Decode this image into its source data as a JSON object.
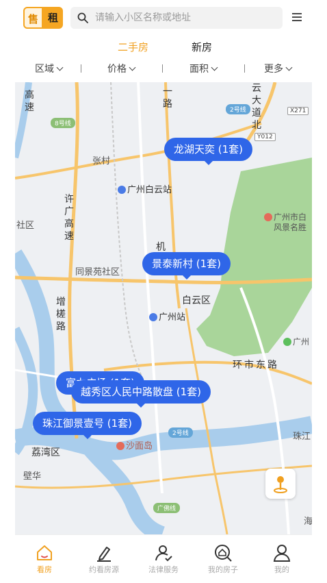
{
  "header": {
    "mode_sell": "售",
    "mode_rent": "租",
    "search_placeholder": "请输入小区名称或地址",
    "icons": {
      "search": "search-icon",
      "menu": "menu-icon"
    }
  },
  "tabs": [
    {
      "label": "二手房",
      "active": true
    },
    {
      "label": "新房",
      "active": false
    }
  ],
  "filters": [
    {
      "label": "区域"
    },
    {
      "label": "价格"
    },
    {
      "label": "面积"
    },
    {
      "label": "更多"
    }
  ],
  "map": {
    "labels": {
      "baiyun_station": "广州白云站",
      "guangzhou_station": "广州站",
      "baiyun_district": "白云区",
      "tongjingyuan": "同景苑社区",
      "zhangcun": "张村",
      "shamian": "沙面岛",
      "liwan": "荔湾区",
      "bihua": "壁华",
      "huanshi_road": "环市东路",
      "zhujiang": "珠江",
      "ji": "机",
      "she_qu": "社区",
      "scenic": "广州市白云山风景名胜区",
      "scenic_line1": "广州市白",
      "scenic_line2": "风景名胜",
      "guang": "广州",
      "hai": "海",
      "gao_su": "高速",
      "xu_guang_gaosu": "许广高速",
      "yi_lu": "一路",
      "zengcha_road": "增槎路",
      "yun_road": "云大道北",
      "lu": "路",
      "xiao": "小环社区"
    },
    "badges": {
      "line8": "8号线",
      "line2_top": "2号线",
      "line2_bottom": "2号线",
      "guangfo": "广佛线"
    },
    "highways": {
      "x271": "X271",
      "y012": "Y012"
    },
    "pins": [
      {
        "label": "龙湖天奕  (1套)"
      },
      {
        "label": "景泰新村  (1套)"
      },
      {
        "label": "富力广场  (1套)"
      },
      {
        "label": "越秀区人民中路散盘  (1套)"
      },
      {
        "label": "珠江御景壹号  (1套)"
      }
    ],
    "locate_icon": "location-pin-icon"
  },
  "nav": [
    {
      "label": "看房",
      "icon": "house-icon",
      "active": true
    },
    {
      "label": "约看房源",
      "icon": "pen-icon",
      "active": false
    },
    {
      "label": "法律服务",
      "icon": "user-check-icon",
      "active": false
    },
    {
      "label": "我的房子",
      "icon": "home-search-icon",
      "active": false
    },
    {
      "label": "我的",
      "icon": "profile-icon",
      "active": false
    }
  ],
  "colors": {
    "accent": "#f0a020",
    "pin": "#2f66e8",
    "park": "#a9d59a",
    "water": "#a9cdec"
  }
}
